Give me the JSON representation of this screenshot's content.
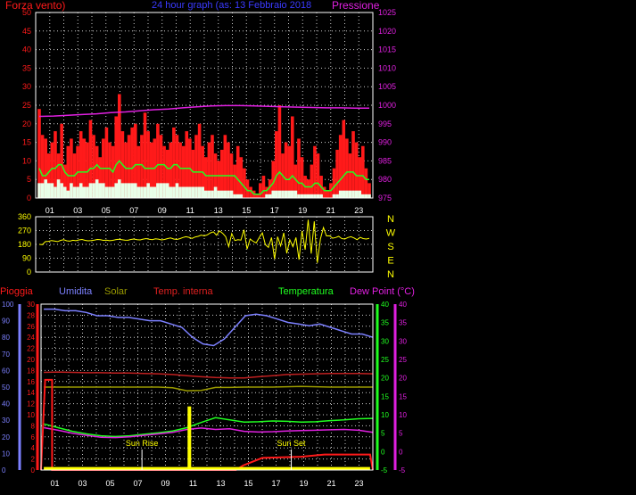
{
  "title": "24 hour graph (as:  13 Febbraio 2018",
  "colors": {
    "red": "#ff1a1a",
    "magenta": "#e020e0",
    "green": "#20ff20",
    "white": "#e8ffe8",
    "yellow": "#ffff00",
    "blue": "#7c80ff",
    "olive": "#9a9a00",
    "darkred": "#c02020",
    "lightgreen": "#60ff60",
    "axis_white": "#ffffff"
  },
  "chart_data": [
    {
      "type": "line",
      "name": "wind-pressure",
      "ylabel_left": "Forza vento)",
      "ylabel_right": "Pressione",
      "ylim_left": [
        0,
        50
      ],
      "ylim_right": [
        975,
        1025
      ],
      "yticks_left": [
        "0",
        "5",
        "10",
        "15",
        "20",
        "25",
        "30",
        "35",
        "40",
        "45",
        "50"
      ],
      "yticks_right": [
        "975",
        "980",
        "985",
        "990",
        "995",
        "1000",
        "1005",
        "1010",
        "1015",
        "1020",
        "1025"
      ],
      "xticks": [
        "01",
        "03",
        "05",
        "07",
        "09",
        "11",
        "13",
        "15",
        "17",
        "19",
        "21",
        "23"
      ],
      "series": [
        {
          "key": "gust",
          "color": "red",
          "values": [
            24,
            17,
            16,
            12,
            15,
            18,
            12,
            20,
            9,
            14,
            16,
            12,
            14,
            18,
            16,
            15,
            21,
            17,
            14,
            11,
            16,
            19,
            15,
            14,
            22,
            28,
            18,
            15,
            17,
            19,
            20,
            14,
            17,
            23,
            18,
            15,
            16,
            20,
            17,
            14,
            13,
            15,
            19,
            17,
            15,
            14,
            18,
            16,
            13,
            17,
            20,
            14,
            11,
            15,
            17,
            12,
            10,
            13,
            17,
            15,
            12,
            9,
            14,
            11,
            8,
            5,
            3,
            2,
            1,
            4,
            6,
            3,
            5,
            10,
            18,
            25,
            12,
            15,
            14,
            22,
            9,
            16,
            11,
            6,
            5,
            9,
            14,
            12,
            6,
            3,
            2,
            4,
            8,
            13,
            17,
            21,
            16,
            12,
            18,
            15,
            11,
            14,
            8,
            4
          ]
        },
        {
          "key": "avg",
          "color": "green",
          "values": [
            8,
            6,
            6,
            7,
            8,
            8,
            9,
            9,
            7,
            6,
            6,
            6,
            7,
            7,
            7,
            7,
            8,
            8,
            9,
            8,
            8,
            8,
            8,
            7,
            9,
            10,
            9,
            8,
            8,
            8,
            9,
            9,
            9,
            8,
            8,
            8,
            8,
            9,
            9,
            9,
            8,
            8,
            9,
            9,
            8,
            8,
            8,
            8,
            7,
            7,
            7,
            7,
            6,
            6,
            6,
            6,
            6,
            6,
            6,
            6,
            6,
            6,
            5,
            4,
            3,
            2,
            2,
            1,
            1,
            1,
            2,
            2,
            3,
            4,
            6,
            7,
            6,
            5,
            5,
            6,
            5,
            4,
            4,
            3,
            3,
            3,
            4,
            4,
            3,
            2,
            2,
            2,
            3,
            4,
            5,
            6,
            7,
            7,
            7,
            6,
            6,
            6,
            5,
            5
          ]
        },
        {
          "key": "min",
          "color": "white",
          "values": [
            4,
            4,
            5,
            4,
            4,
            3,
            5,
            4,
            3,
            2,
            4,
            3,
            3,
            4,
            3,
            3,
            4,
            4,
            5,
            4,
            4,
            3,
            3,
            3,
            4,
            5,
            4,
            4,
            4,
            4,
            4,
            3,
            3,
            3,
            4,
            3,
            3,
            4,
            4,
            4,
            4,
            3,
            3,
            4,
            3,
            3,
            3,
            3,
            3,
            3,
            3,
            3,
            2,
            2,
            2,
            3,
            2,
            2,
            2,
            2,
            2,
            1,
            1,
            1,
            0,
            0,
            0,
            0,
            0,
            0,
            0,
            1,
            1,
            2,
            2,
            2,
            2,
            2,
            2,
            2,
            2,
            1,
            1,
            1,
            1,
            1,
            1,
            1,
            1,
            0,
            0,
            0,
            1,
            1,
            2,
            2,
            2,
            2,
            2,
            2,
            2,
            1,
            1,
            1
          ]
        },
        {
          "key": "pressure",
          "color": "magenta",
          "values": [
            997.0,
            997.1,
            997.3,
            997.5,
            997.7,
            998.0,
            998.2,
            998.5,
            998.8,
            999.0,
            999.3,
            999.6,
            999.8,
            999.9,
            999.9,
            999.8,
            999.7,
            999.6,
            999.5,
            999.4,
            999.3,
            999.3,
            999.2,
            999.2
          ]
        }
      ]
    },
    {
      "type": "line",
      "name": "wind-direction",
      "ylim": [
        0,
        360
      ],
      "yticks": [
        "0",
        "90",
        "180",
        "270",
        "360"
      ],
      "compass": [
        "N",
        "W",
        "S",
        "E",
        "N"
      ],
      "series": [
        {
          "key": "direction",
          "color": "yellow",
          "values": [
            180,
            178,
            198,
            200,
            205,
            202,
            198,
            206,
            210,
            203,
            201,
            207,
            204,
            209,
            212,
            206,
            203,
            205,
            208,
            212,
            210,
            206,
            208,
            204,
            206,
            210,
            213,
            211,
            208,
            207,
            212,
            215,
            211,
            209,
            214,
            218,
            213,
            211,
            216,
            214,
            209,
            212,
            218,
            222,
            215,
            212,
            217,
            225,
            230,
            226,
            219,
            228,
            232,
            240,
            235,
            242,
            255,
            262,
            240,
            268,
            252,
            230,
            165,
            250,
            205,
            210,
            208,
            275,
            150,
            215,
            200,
            190,
            225,
            255,
            178,
            160,
            225,
            85,
            230,
            170,
            255,
            122,
            210,
            165,
            225,
            80,
            268,
            145,
            340,
            120,
            330,
            60,
            215,
            290,
            235,
            236,
            220,
            225,
            232,
            218,
            215,
            225,
            230,
            222,
            210,
            226,
            218,
            215,
            219
          ]
        }
      ]
    },
    {
      "type": "line",
      "name": "rain-humidity-temperature",
      "labels": {
        "rain": "Pioggia",
        "humidity": "Umidita",
        "solar": "Solar",
        "indoor": "Temp. interna",
        "temperature": "Temperatura",
        "dewpoint": "Dew Point (°C)"
      },
      "yticks_rain": [
        "0",
        "2",
        "4",
        "6",
        "8",
        "10",
        "12",
        "14",
        "16",
        "18",
        "20",
        "22",
        "24",
        "26",
        "28",
        "30"
      ],
      "yticks_humidity": [
        "0",
        "10",
        "20",
        "30",
        "40",
        "50",
        "60",
        "70",
        "80",
        "90",
        "100"
      ],
      "yticks_temp_right1": [
        "-5",
        "0",
        "5",
        "10",
        "15",
        "20",
        "25",
        "30",
        "35",
        "40"
      ],
      "yticks_temp_right2": [
        "-5",
        "0",
        "5",
        "10",
        "15",
        "20",
        "25",
        "30",
        "35",
        "40"
      ],
      "ylim_rain": [
        0,
        30
      ],
      "ylim_humidity": [
        0,
        100
      ],
      "ylim_temp": [
        -5,
        40
      ],
      "xticks": [
        "01",
        "03",
        "05",
        "07",
        "09",
        "11",
        "13",
        "15",
        "17",
        "19",
        "21",
        "23"
      ],
      "annotations": [
        {
          "label": "Sun Rise",
          "hour": 7.3
        },
        {
          "label": "Sun Set",
          "hour": 18.1
        }
      ],
      "series": [
        {
          "key": "humidity",
          "color": "blue",
          "values": [
            97,
            97,
            96,
            96,
            95,
            93,
            93,
            92,
            92,
            91,
            90,
            90,
            88,
            86,
            80,
            76,
            75,
            79,
            86,
            93,
            94,
            93,
            91,
            89,
            88,
            87,
            88,
            86,
            84,
            82,
            82,
            80
          ]
        },
        {
          "key": "indoor_temp",
          "color": "darkred",
          "values": [
            21.5,
            21.6,
            21.5,
            21.4,
            21.4,
            21.3,
            21.3,
            21.2,
            21.1,
            20.9,
            20.6,
            20.3,
            20.1,
            20.0,
            20.0,
            20.3,
            20.6,
            20.9,
            21.0,
            21.1,
            21.2,
            21.2,
            21.2,
            21.1
          ]
        },
        {
          "key": "solar",
          "color": "olive",
          "values": [
            17.5,
            17.5,
            17.5,
            17.5,
            17.5,
            17.5,
            17.5,
            17.5,
            17.5,
            17.3,
            16.5,
            16.6,
            17.4,
            17.4,
            17.5,
            17.5,
            17.5,
            17.6,
            17.7,
            17.6,
            17.5,
            17.5,
            17.5,
            17.5
          ]
        },
        {
          "key": "temperature",
          "color": "green",
          "values": [
            7.5,
            6.5,
            5.5,
            4.8,
            4.3,
            4.1,
            4.3,
            4.7,
            5.1,
            5.6,
            6.5,
            7.9,
            9.2,
            8.6,
            8.0,
            8.1,
            8.3,
            8.2,
            8.0,
            8.1,
            8.4,
            8.6,
            8.9,
            9.0
          ]
        },
        {
          "key": "dewpoint",
          "color": "magenta",
          "values": [
            6.5,
            5.8,
            5.0,
            4.4,
            3.9,
            3.8,
            4.0,
            4.4,
            4.8,
            5.2,
            6.0,
            6.4,
            6.0,
            6.2,
            5.5,
            5.3,
            5.4,
            5.6,
            5.7,
            5.8,
            5.9,
            6.0,
            5.8,
            5.2
          ]
        },
        {
          "key": "rain",
          "color": "red",
          "points": [
            [
              0.0,
              0
            ],
            [
              0.3,
              16.3
            ],
            [
              0.8,
              16.3
            ],
            [
              0.8,
              0
            ],
            [
              14.1,
              0
            ],
            [
              14.6,
              0.8
            ],
            [
              15.4,
              1.6
            ],
            [
              16.0,
              2.2
            ],
            [
              18.8,
              2.4
            ],
            [
              20.5,
              2.8
            ],
            [
              23.8,
              2.8
            ],
            [
              24.0,
              0
            ]
          ]
        },
        {
          "key": "rain_rate",
          "color": "yellow",
          "points": [
            [
              0.2,
              0.3
            ],
            [
              23.8,
              0.3
            ]
          ]
        },
        {
          "key": "rain_bar",
          "color": "yellow",
          "hour": 10.6,
          "value": 11.5
        }
      ]
    }
  ]
}
